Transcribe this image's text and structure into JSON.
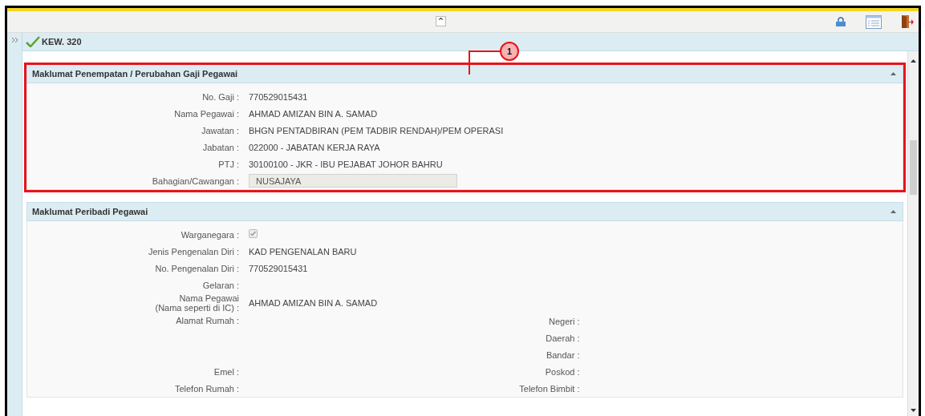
{
  "toolbar": {
    "collapse_symbol": "⌃"
  },
  "tab": {
    "title": "KEW. 320"
  },
  "callouts": [
    {
      "label": "1"
    }
  ],
  "sections": [
    {
      "title": "Maklumat Penempatan / Perubahan Gaji Pegawai",
      "expanded": true,
      "highlighted": true,
      "rows": [
        {
          "kind": "text",
          "label": "No. Gaji :",
          "value": "770529015431"
        },
        {
          "kind": "text",
          "label": "Nama Pegawai :",
          "value": "AHMAD AMIZAN BIN A. SAMAD"
        },
        {
          "kind": "text",
          "label": "Jawatan :",
          "value": "BHGN PENTADBIRAN (PEM TADBIR RENDAH)/PEM OPERASI"
        },
        {
          "kind": "text",
          "label": "Jabatan :",
          "value": "022000 - JABATAN KERJA RAYA"
        },
        {
          "kind": "text",
          "label": "PTJ :",
          "value": "30100100 - JKR - IBU PEJABAT JOHOR BAHRU"
        },
        {
          "kind": "input",
          "label": "Bahagian/Cawangan :",
          "value": "NUSAJAYA"
        }
      ]
    },
    {
      "title": "Maklumat Peribadi Pegawai",
      "expanded": true,
      "highlighted": false,
      "rows": [
        {
          "kind": "checkbox",
          "label": "Warganegara :",
          "checked": true
        },
        {
          "kind": "text",
          "label": "Jenis Pengenalan Diri :",
          "value": "KAD PENGENALAN BARU"
        },
        {
          "kind": "text",
          "label": "No. Pengenalan Diri :",
          "value": "770529015431"
        },
        {
          "kind": "text",
          "label": "Gelaran :"
        },
        {
          "kind": "twoline",
          "label": "Nama Pegawai",
          "sublabel": "(Nama seperti di IC) :",
          "value": "AHMAD AMIZAN BIN A. SAMAD"
        }
      ],
      "left_rows": [
        {
          "kind": "address",
          "label": "Alamat Rumah :"
        },
        {
          "kind": "text",
          "label": "Emel :"
        },
        {
          "kind": "text",
          "label": "Telefon Rumah :"
        }
      ],
      "right_rows": [
        {
          "kind": "text",
          "label": "Negeri :"
        },
        {
          "kind": "text",
          "label": "Daerah :"
        },
        {
          "kind": "text",
          "label": "Bandar :"
        },
        {
          "kind": "text",
          "label": "Poskod :"
        },
        {
          "kind": "text",
          "label": "Telefon Bimbit :"
        }
      ]
    }
  ]
}
